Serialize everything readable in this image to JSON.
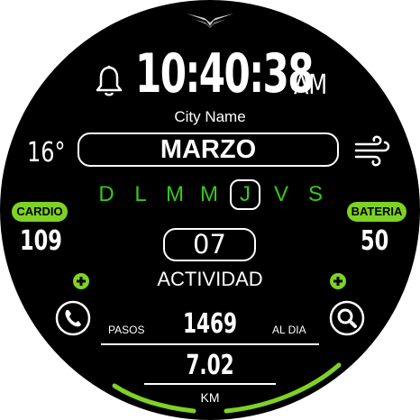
{
  "clock": {
    "time": "10:40:38",
    "ampm": "AM"
  },
  "weather": {
    "city": "City Name",
    "temperature": "16°",
    "icon": "wind-icon"
  },
  "calendar": {
    "month": "MARZO",
    "days": [
      "D",
      "L",
      "M",
      "M",
      "J",
      "V",
      "S"
    ],
    "active_day_index": 4,
    "date": "07"
  },
  "cardio": {
    "label": "CARDIO",
    "value": "109"
  },
  "battery": {
    "label": "BATERIA",
    "value": "50"
  },
  "activity": {
    "title": "ACTIVIDAD",
    "steps_label": "PASOS",
    "steps": "1469",
    "per_day_label": "AL DIA",
    "distance": "7.02",
    "distance_unit": "KM"
  },
  "icons": [
    "brand-logo-icon",
    "bell-icon",
    "wind-icon",
    "phone-icon",
    "search-icon",
    "plus-icon"
  ],
  "colors": {
    "accent": "#7fd225",
    "weekday": "#36c71d",
    "background": "#000000",
    "text": "#ffffff"
  }
}
